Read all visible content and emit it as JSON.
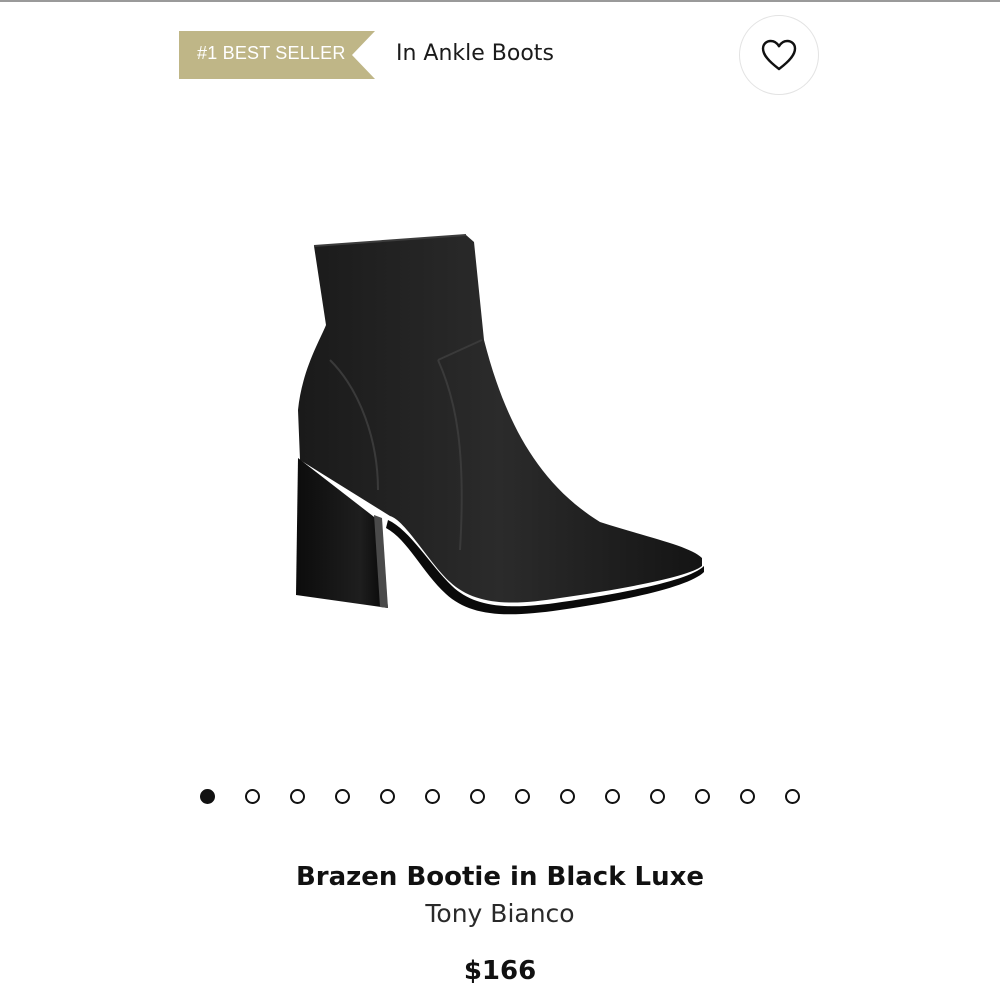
{
  "badge": {
    "label": "#1 BEST SELLER",
    "color": "#bfb687"
  },
  "category": {
    "label": "In Ankle Boots"
  },
  "favorite": {
    "icon": "heart-outline-icon"
  },
  "product": {
    "image": "black-ankle-bootie-photo",
    "name": "Brazen Bootie in Black Luxe",
    "brand": "Tony Bianco",
    "price": "$166"
  },
  "carousel": {
    "total": 14,
    "active_index": 0
  }
}
